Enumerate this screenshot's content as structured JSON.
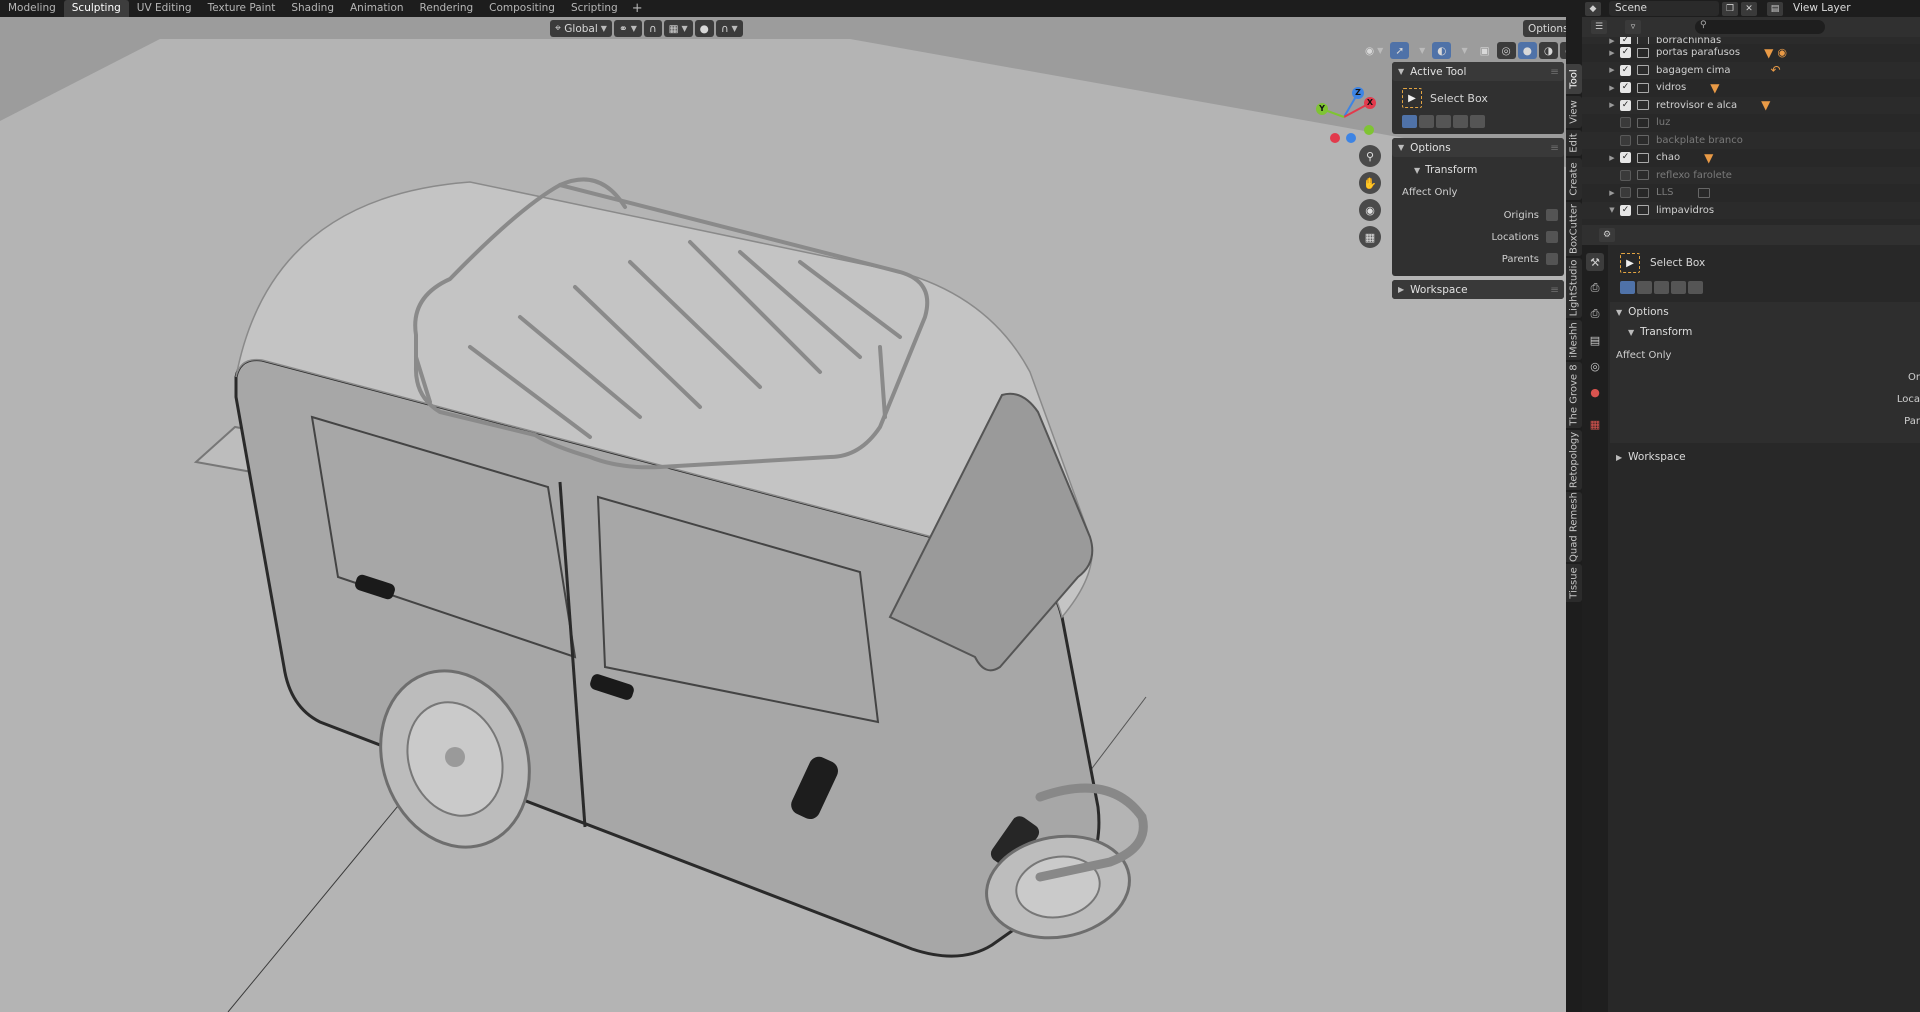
{
  "workspaces": {
    "tabs": [
      "Modeling",
      "Sculpting",
      "UV Editing",
      "Texture Paint",
      "Shading",
      "Animation",
      "Rendering",
      "Compositing",
      "Scripting"
    ],
    "active": "Sculpting",
    "add": "+"
  },
  "scene": {
    "name": "Scene",
    "view_layer": "View Layer"
  },
  "viewport": {
    "orientation": "Global",
    "options": "Options",
    "gizmo_axes": {
      "x": "X",
      "y": "Y",
      "z": "Z"
    }
  },
  "tool_panel": {
    "active_tool_heading": "Active Tool",
    "tool_name": "Select Box",
    "options_heading": "Options",
    "transform_heading": "Transform",
    "affect_only": "Affect Only",
    "origins": "Origins",
    "locations": "Locations",
    "parents": "Parents",
    "workspace_heading": "Workspace"
  },
  "sidebar_tabs": [
    "Tool",
    "View",
    "Edit",
    "Create",
    "BoxCutter",
    "LightStudio",
    "iMeshh",
    "The Grove 8",
    "Retopology",
    "Quad Remesh",
    "Tissue"
  ],
  "outliner": {
    "rows": [
      {
        "name": "borrachinhas",
        "checked": true,
        "dim": false
      },
      {
        "name": "portas parafusos",
        "checked": true,
        "dim": false
      },
      {
        "name": "bagagem cima",
        "checked": true,
        "dim": false
      },
      {
        "name": "vidros",
        "checked": true,
        "dim": false
      },
      {
        "name": "retrovisor e alca",
        "checked": true,
        "dim": false
      },
      {
        "name": "luz",
        "checked": false,
        "dim": true
      },
      {
        "name": "backplate branco",
        "checked": false,
        "dim": true
      },
      {
        "name": "chao",
        "checked": true,
        "dim": false
      },
      {
        "name": "reflexo farolete",
        "checked": false,
        "dim": true
      },
      {
        "name": "LLS",
        "checked": false,
        "dim": true
      },
      {
        "name": "limpavidros",
        "checked": true,
        "dim": false
      }
    ]
  },
  "properties": {
    "tool_name": "Select Box",
    "options_heading": "Options",
    "transform_heading": "Transform",
    "affect_only": "Affect Only",
    "origins_trunc": "Or",
    "locations_trunc": "Loca",
    "parents_trunc": "Par",
    "workspace_heading": "Workspace"
  },
  "colors": {
    "viewport_bg": "#b3b3b3",
    "accent": "#4f72a8",
    "axis_x": "#e23a4c",
    "axis_y": "#7fc433",
    "axis_z": "#3d84e4",
    "object_tag": "#e99a46"
  }
}
